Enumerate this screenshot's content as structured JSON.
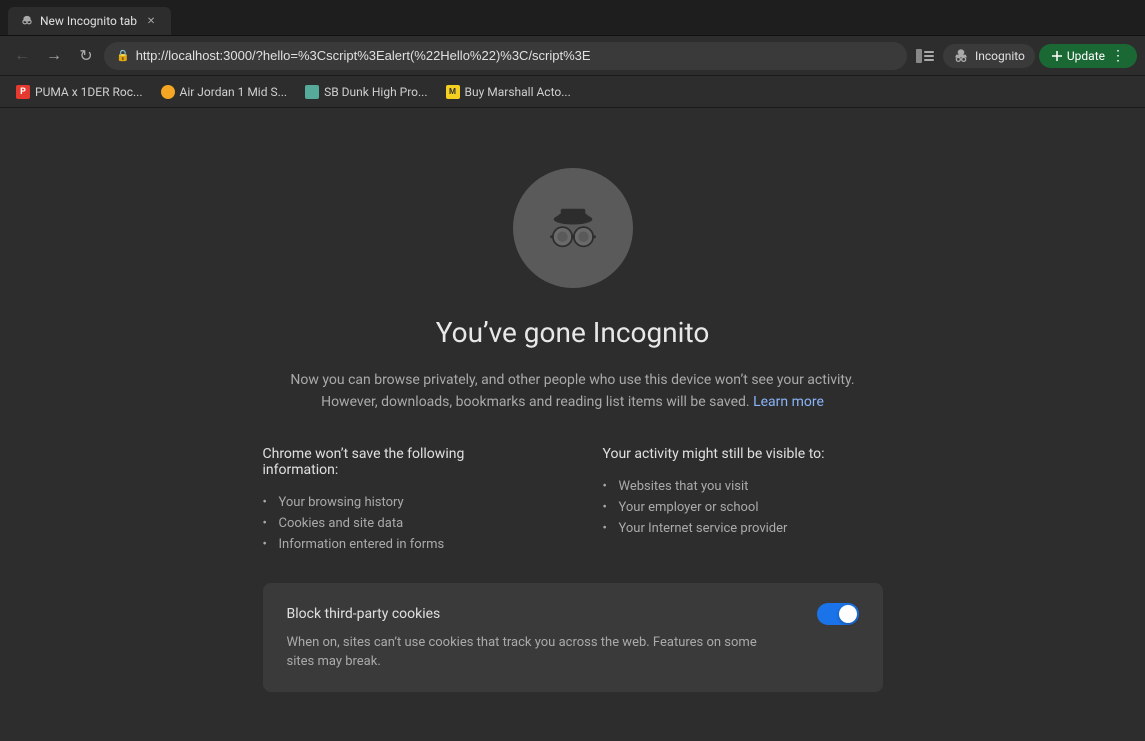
{
  "browser": {
    "tab": {
      "label": "New Incognito tab",
      "icon": "incognito"
    },
    "address": "http://localhost:3000/?hello=%3Cscript%3Ealert(%22Hello%22)%3C/script%3E",
    "incognito_label": "Incognito",
    "update_label": "Update",
    "bookmarks": [
      {
        "label": "PUMA x 1DER Roc...",
        "favicon": "puma"
      },
      {
        "label": "Air Jordan 1 Mid S...",
        "favicon": "nike"
      },
      {
        "label": "SB Dunk High Pro...",
        "favicon": "sb"
      },
      {
        "label": "Buy Marshall Acto...",
        "favicon": "marshall"
      }
    ]
  },
  "page": {
    "title": "You’ve gone Incognito",
    "description_part1": "Now you can browse privately, and other people who use this device won’t see your activity. However, downloads, bookmarks and reading list items will be saved.",
    "learn_more": "Learn more",
    "not_saved_title": "Chrome won’t save the following information:",
    "not_saved_items": [
      "Your browsing history",
      "Cookies and site data",
      "Information entered in forms"
    ],
    "still_visible_title": "Your activity might still be visible to:",
    "still_visible_items": [
      "Websites that you visit",
      "Your employer or school",
      "Your Internet service provider"
    ],
    "cookie_block_title": "Block third-party cookies",
    "cookie_block_desc": "When on, sites can’t use cookies that track you across the web. Features on some sites may break.",
    "cookie_toggle_enabled": true
  }
}
